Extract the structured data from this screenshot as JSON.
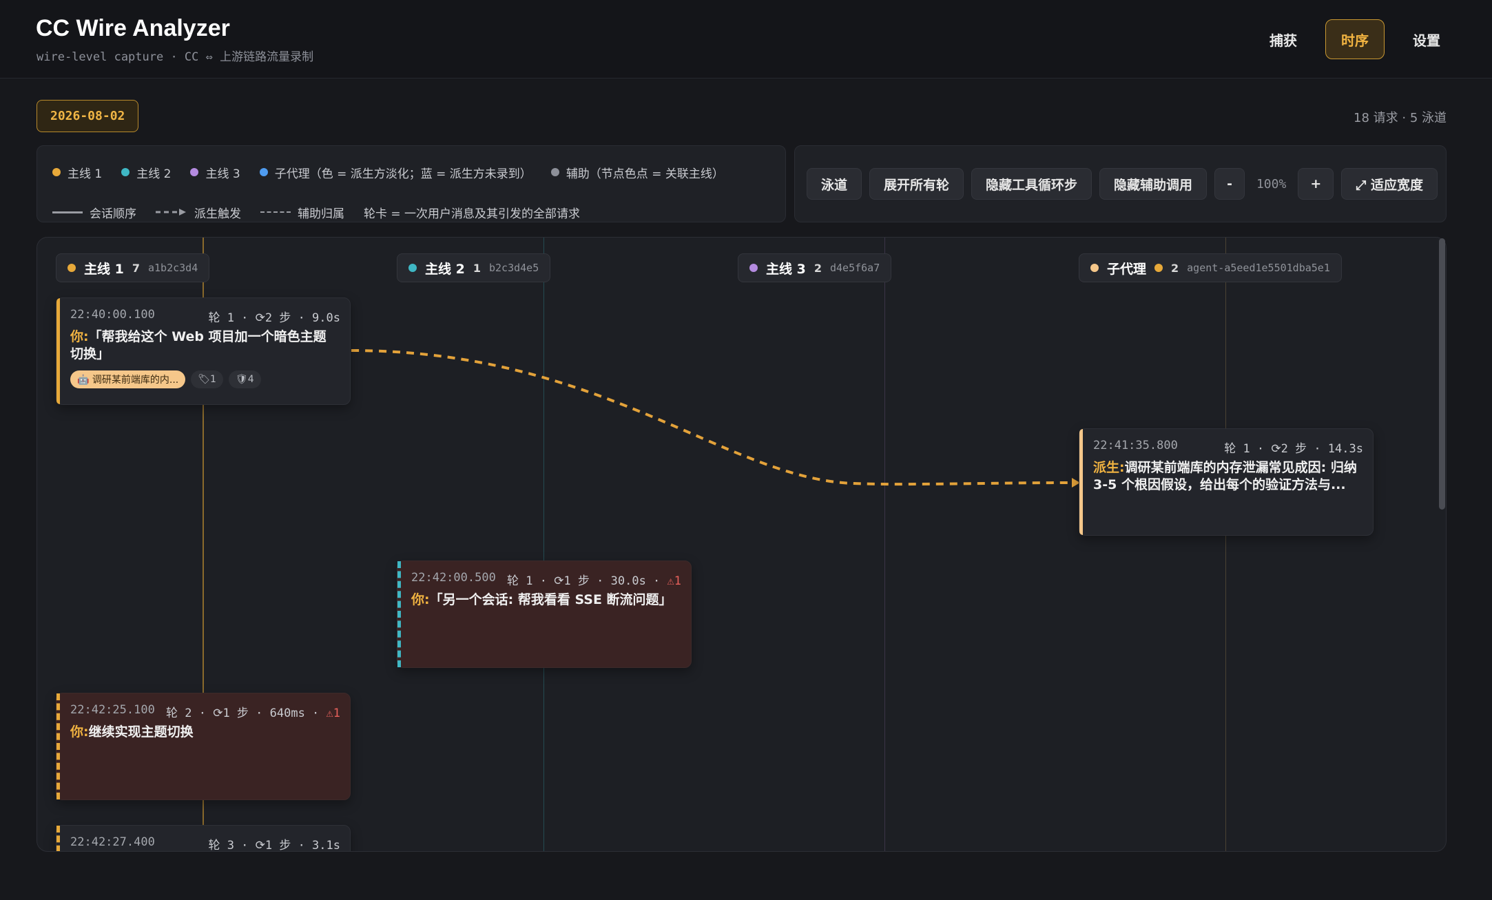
{
  "app": {
    "title": "CC Wire Analyzer",
    "subtitle": "wire-level capture · CC ⇔ 上游链路流量录制"
  },
  "nav": {
    "capture": "捕获",
    "timeline": "时序",
    "settings": "设置"
  },
  "date": "2026-08-02",
  "summary": "18 请求 · 5 泳道",
  "legend": {
    "lanes": [
      {
        "label": "主线 1",
        "color": "#e7a93a"
      },
      {
        "label": "主线 2",
        "color": "#3fb7c4"
      },
      {
        "label": "主线 3",
        "color": "#b48be0"
      },
      {
        "label": "子代理（色 = 派生方淡化；蓝 = 派生方未录到）",
        "color": "#4f9cf0"
      },
      {
        "label": "辅助（节点色点 = 关联主线）",
        "color": "#8d9099"
      }
    ],
    "session_order": "会话顺序",
    "spawn_trigger": "派生触发",
    "aux_belong": "辅助归属",
    "turn_card_note": "轮卡 = 一次用户消息及其引发的全部请求"
  },
  "toolbar": {
    "swimlane": "泳道",
    "expand_all": "展开所有轮",
    "hide_tool_loop": "隐藏工具循环步",
    "hide_aux": "隐藏辅助调用",
    "zoom_out": "-",
    "zoom": "100%",
    "zoom_in": "+",
    "fit_width": "⤢ 适应宽度"
  },
  "lanes": [
    {
      "name": "主线 1",
      "count": "7",
      "id": "a1b2c3d4",
      "color": "#e7a93a"
    },
    {
      "name": "主线 2",
      "count": "1",
      "id": "b2c3d4e5",
      "color": "#3fb7c4"
    },
    {
      "name": "主线 3",
      "count": "2",
      "id": "d4e5f6a7",
      "color": "#b48be0"
    },
    {
      "name": "子代理",
      "count": "2",
      "id": "agent-a5eed1e5501dba5e1",
      "color": "#f5c78a",
      "parent_color": "#e7a93a"
    }
  ],
  "cards": [
    {
      "time": "22:40:00.100",
      "stats": "轮 1 · ⟳2 步 · 9.0s",
      "who": "你:",
      "text": "「帮我给这个 Web 项目加一个暗色主题切换」",
      "chip_agent": "🤖 调研某前端库的内...",
      "chip_tag": "🏷1",
      "chip_shield": "🛡4"
    },
    {
      "time": "22:41:35.800",
      "stats": "轮 1 · ⟳2 步 · 14.3s",
      "who": "派生:",
      "text": "调研某前端库的内存泄漏常见成因: 归纳 3-5 个根因假设，给出每个的验证方法与..."
    },
    {
      "time": "22:42:00.500",
      "stats": "轮 1 · ⟳1 步 · 30.0s · ",
      "warn": "⚠1",
      "who": "你:",
      "text": "「另一个会话: 帮我看看 SSE 断流问题」"
    },
    {
      "time": "22:42:25.100",
      "stats": "轮 2 · ⟳1 步 · 640ms · ",
      "warn": "⚠1",
      "who": "你:",
      "text": "继续实现主题切换"
    },
    {
      "time": "22:42:27.400",
      "stats": "轮 3 · ⟳1 步 · 3.1s"
    }
  ]
}
